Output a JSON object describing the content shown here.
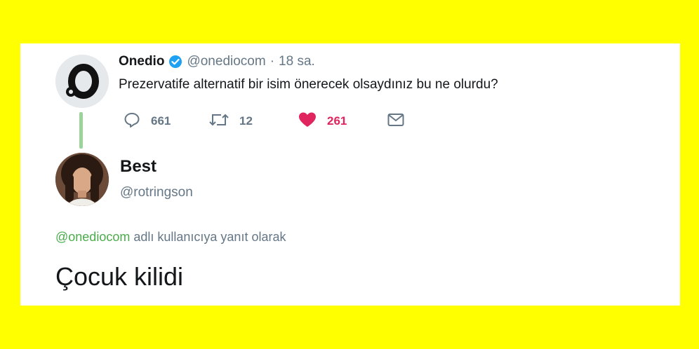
{
  "tweet": {
    "author_name": "Onedio",
    "author_handle": "@onediocom",
    "separator": "·",
    "time": "18 sa.",
    "text": "Prezervatife alternatif bir isim önerecek olsaydınız bu ne olurdu?",
    "replies": "661",
    "retweets": "12",
    "likes": "261"
  },
  "reply": {
    "author_name": "Best",
    "author_handle": "@rotringson",
    "reply_to_mention": "@onediocom",
    "reply_to_suffix": "adlı kullanıcıya yanıt olarak",
    "text": "Çocuk kilidi"
  },
  "colors": {
    "background": "#ffff00",
    "like": "#e0245e",
    "muted": "#657786",
    "thread_line": "#9bd39b",
    "mention": "#4aab4a",
    "verified": "#1da1f2"
  },
  "icons": {
    "reply": "reply-icon",
    "retweet": "retweet-icon",
    "like": "heart-icon",
    "dm": "envelope-icon",
    "verified": "verified-badge-icon"
  }
}
